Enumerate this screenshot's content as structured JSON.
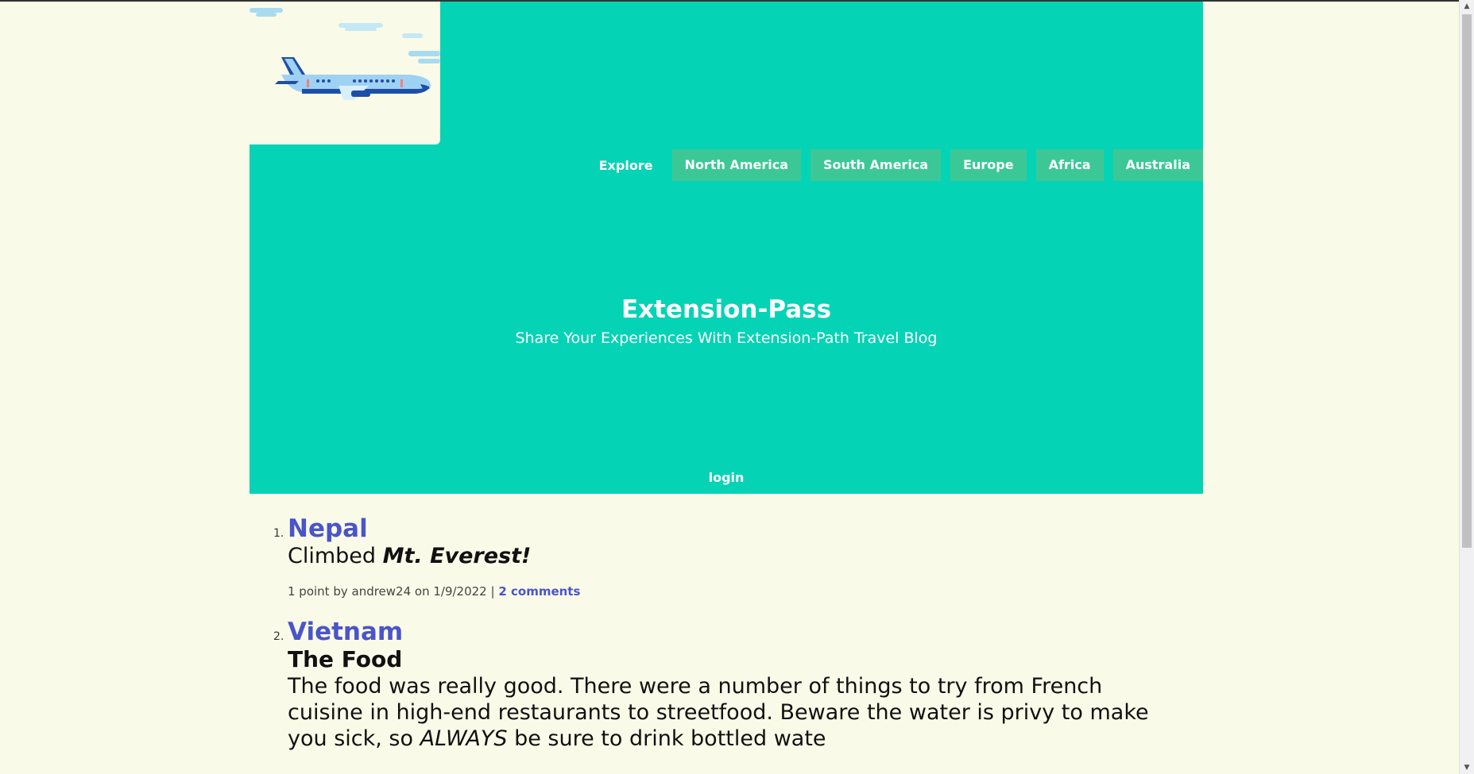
{
  "nav": {
    "explore": "Explore",
    "items": [
      "North America",
      "South America",
      "Europe",
      "Africa",
      "Australia"
    ]
  },
  "site": {
    "title": "Extension-Pass",
    "tagline": "Share Your Experiences With Extension-Path Travel Blog",
    "login": "login"
  },
  "posts": [
    {
      "num": "1.",
      "title": "Nepal",
      "summary_text": "Climbed",
      "summary_emph": "Mt. Everest!",
      "meta_text": "1 point by andrew24 on 1/9/2022 |",
      "comments": "2 comments"
    },
    {
      "num": "2.",
      "title": "Vietnam",
      "subtitle": "The Food",
      "body_start": "The food was really good. There were a number of things to try from French cuisine in high-end restaurants to streetfood. Beware the water is privy to make you sick, so",
      "body_emph": "ALWAYS",
      "body_end": "be sure to drink bottled wate"
    }
  ],
  "colors": {
    "hero": "#05d3b5",
    "nav_button": "#3cc896",
    "link": "#4a55c8",
    "page_bg": "#f9fbe8"
  },
  "icons": {
    "logo": "airplane-illustration"
  }
}
